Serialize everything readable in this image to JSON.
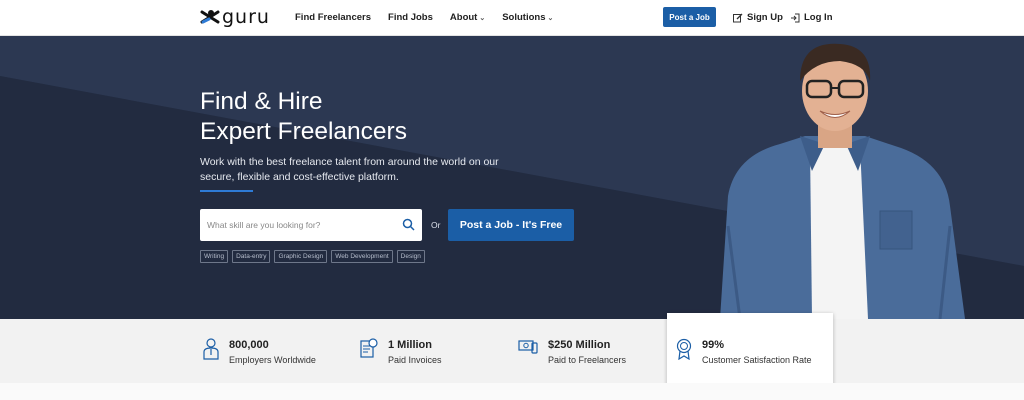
{
  "brand": {
    "name": "guru"
  },
  "nav": {
    "links": [
      "Find Freelancers",
      "Find Jobs",
      "About",
      "Solutions"
    ],
    "post_job": "Post a Job",
    "sign_up": "Sign Up",
    "log_in": "Log In"
  },
  "hero": {
    "title_line1": "Find & Hire",
    "title_line2": "Expert Freelancers",
    "subtitle": "Work with the best freelance talent from around the world on our secure, flexible and cost-effective platform.",
    "search_placeholder": "What skill are you looking for?",
    "or": "Or",
    "cta": "Post a Job - It's Free",
    "tags": [
      "Writing",
      "Data-entry",
      "Graphic Design",
      "Web Development",
      "Design"
    ]
  },
  "stats": [
    {
      "value": "800,000",
      "label": "Employers Worldwide",
      "icon": "person-icon"
    },
    {
      "value": "1 Million",
      "label": "Paid Invoices",
      "icon": "invoice-icon"
    },
    {
      "value": "$250 Million",
      "label": "Paid to Freelancers",
      "icon": "money-icon"
    },
    {
      "value": "99%",
      "label": "Customer Satisfaction Rate",
      "icon": "award-icon"
    }
  ],
  "colors": {
    "accent": "#1b5ea6",
    "hero_bg": "#263149",
    "stats_bg": "#f2f2f2"
  }
}
